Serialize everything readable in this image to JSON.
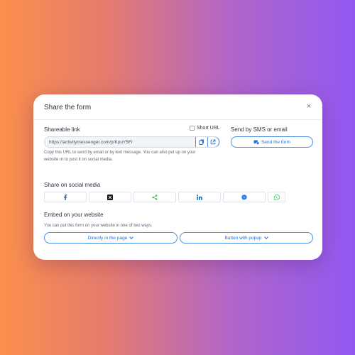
{
  "modal": {
    "title": "Share the form",
    "close_glyph": "×"
  },
  "shareable_link": {
    "label": "Shareable link",
    "short_url_label": "Short URL",
    "short_url_checked": false,
    "url": "https://activitymessenger.com/p/KpuY5Fi",
    "copy_icon": "copy-icon",
    "open_icon": "external-link-icon",
    "help_line1": "Copy this URL to send by email or by text message. You can also put up on your",
    "help_line2": "website or to post it on social media."
  },
  "sms": {
    "label": "Send by SMS or email",
    "button_label": "Send the form",
    "button_icon": "send-message-icon"
  },
  "social": {
    "label": "Share on social media",
    "items": [
      {
        "name": "facebook",
        "icon": "facebook-icon",
        "color": "#3b5998"
      },
      {
        "name": "x",
        "icon": "x-icon",
        "color": "#111111"
      },
      {
        "name": "share",
        "icon": "share-icon",
        "color": "#4cbf4a"
      },
      {
        "name": "linkedin",
        "icon": "linkedin-icon",
        "color": "#0a66c2"
      },
      {
        "name": "messenger",
        "icon": "messenger-icon",
        "color": "#2f7cf6"
      },
      {
        "name": "whatsapp",
        "icon": "whatsapp-icon",
        "color": "#25d366"
      }
    ]
  },
  "embed": {
    "label": "Embed on your website",
    "help": "You can put this form on your website in one of two ways.",
    "option1_label": "Directly in the page",
    "option2_label": "Button with popup"
  },
  "colors": {
    "accent": "#4a90e2",
    "accent_text": "#2d6fd0"
  }
}
